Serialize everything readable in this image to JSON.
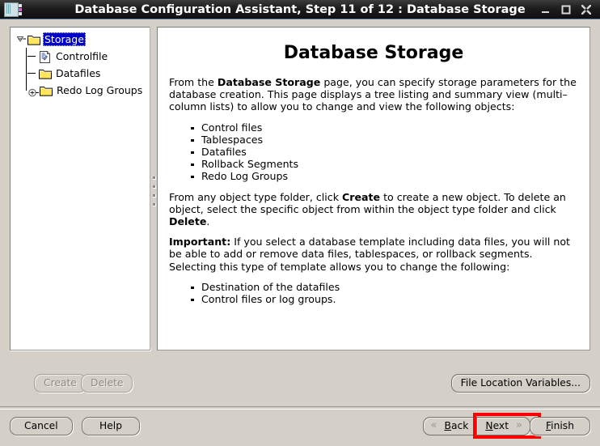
{
  "window": {
    "title": "Database Configuration Assistant, Step 11 of 12 : Database Storage",
    "app_icon": "database-app-icon",
    "controls": {
      "minimize": "minimize-icon",
      "maximize": "maximize-icon",
      "close": "close-icon"
    }
  },
  "tree": {
    "nodes": [
      {
        "label": "Storage",
        "icon": "folder-icon",
        "handle": "collapse-minus-icon",
        "selected": true
      },
      {
        "label": "Controlfile",
        "icon": "controlfile-document-icon",
        "handle": "none",
        "selected": false
      },
      {
        "label": "Datafiles",
        "icon": "folder-icon",
        "handle": "none",
        "selected": false
      },
      {
        "label": "Redo Log Groups",
        "icon": "folder-icon",
        "handle": "expand-plus-icon",
        "selected": false
      }
    ]
  },
  "content": {
    "heading": "Database Storage",
    "para1": {
      "t1": "From the ",
      "b1": "Database Storage",
      "t2": " page, you can specify storage parameters for the database creation. This page displays a tree listing and summary view (multi–column lists) to allow you to change and view the following objects:"
    },
    "list1": [
      "Control files",
      "Tablespaces",
      "Datafiles",
      "Rollback Segments",
      "Redo Log Groups"
    ],
    "para2": {
      "t1": "From any object type folder, click ",
      "b1": "Create",
      "t2": " to create a new object. To delete an object, select the specific object from within the object type folder and click ",
      "b2": "Delete",
      "t3": "."
    },
    "para3": {
      "b1": "Important:",
      "t1": " If you select a database template including data files, you will not be able to add or remove data files, tablespaces, or rollback segments. Selecting this type of template allows you to change the following:"
    },
    "list2": [
      "Destination of the datafiles",
      "Control files or log groups."
    ]
  },
  "aux_buttons": {
    "create": "Create",
    "delete": "Delete",
    "file_location_variables": "File Location Variables..."
  },
  "nav_buttons": {
    "cancel": "Cancel",
    "help": "Help",
    "back": "Back",
    "back_mnemonic": "B",
    "back_rest": "ack",
    "next": "Next",
    "next_mnemonic": "N",
    "next_rest": "ext",
    "finish": "Finish",
    "finish_mnemonic": "F",
    "finish_rest": "inish",
    "back_chevron": "«",
    "next_chevron": "»"
  },
  "colors": {
    "selection_blue": "#0000c8",
    "highlight_red": "#ff0000",
    "window_bg": "#d4d0c8",
    "panel_bg": "#ffffff",
    "titlebar_bg": "#1d1d1d"
  }
}
